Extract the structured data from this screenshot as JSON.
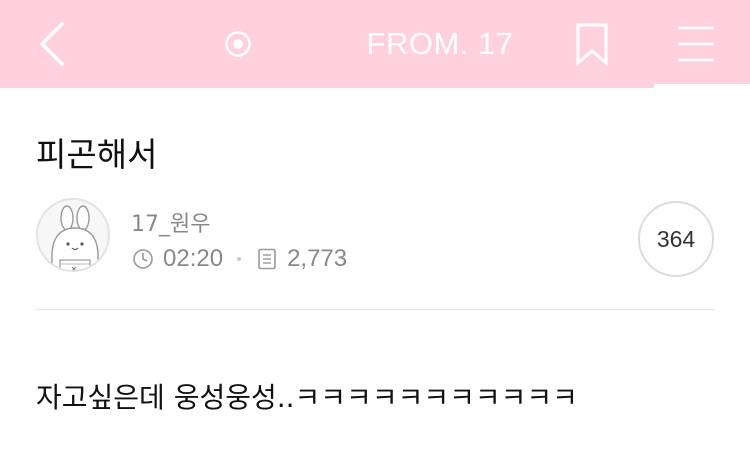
{
  "header": {
    "title": "FROM. 17",
    "back_icon": "chevron-left-icon",
    "live_icon": "record-circle-icon",
    "bookmark_icon": "bookmark-icon",
    "menu_icon": "hamburger-menu-icon",
    "background_color": "#ffd0dd"
  },
  "post": {
    "title": "피곤해서",
    "author": "17_원우",
    "time": "02:20",
    "post_count": "2,773",
    "views": "364",
    "body": "자고싶은데 웅성웅성..ㅋㅋㅋㅋㅋㅋㅋㅋㅋㅋㅋ"
  }
}
